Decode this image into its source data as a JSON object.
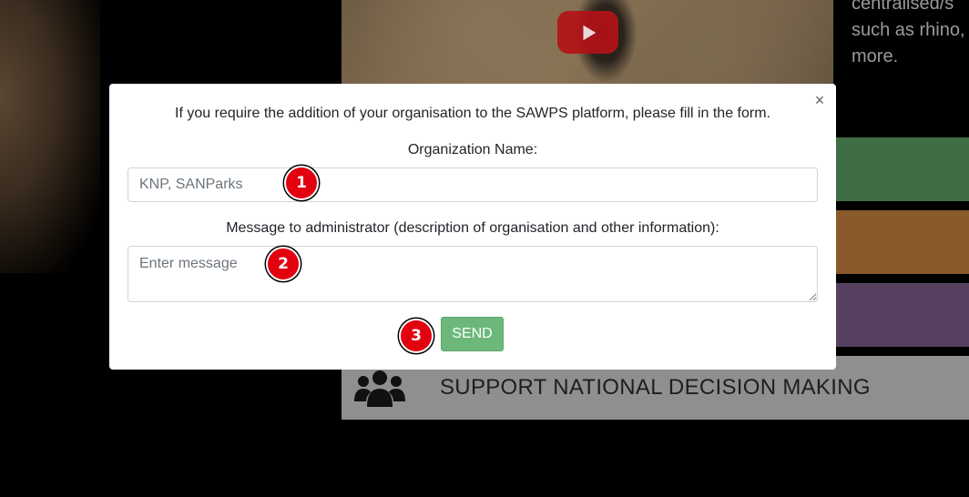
{
  "background": {
    "right_text_lines": [
      "centralised/s",
      "such as rhino,",
      "more."
    ],
    "support_bar_label": "SUPPORT NATIONAL DECISION MAKING",
    "colors": {
      "green_tile": "#3f6e46",
      "orange_tile": "#8a5a2c",
      "purple_tile": "#56405f",
      "support_bar": "#8f8f8f"
    }
  },
  "modal": {
    "intro": "If you require the addition of your organisation to the SAWPS platform, please fill in the form.",
    "close_label": "×",
    "org_label": "Organization Name:",
    "org_placeholder": "KNP, SANParks",
    "org_value": "",
    "message_label": "Message to administrator (description of organisation and other information):",
    "message_placeholder": "Enter message",
    "message_value": "",
    "send_label": "SEND",
    "send_color": "#6cb87b"
  },
  "markers": [
    "1",
    "2",
    "3"
  ]
}
